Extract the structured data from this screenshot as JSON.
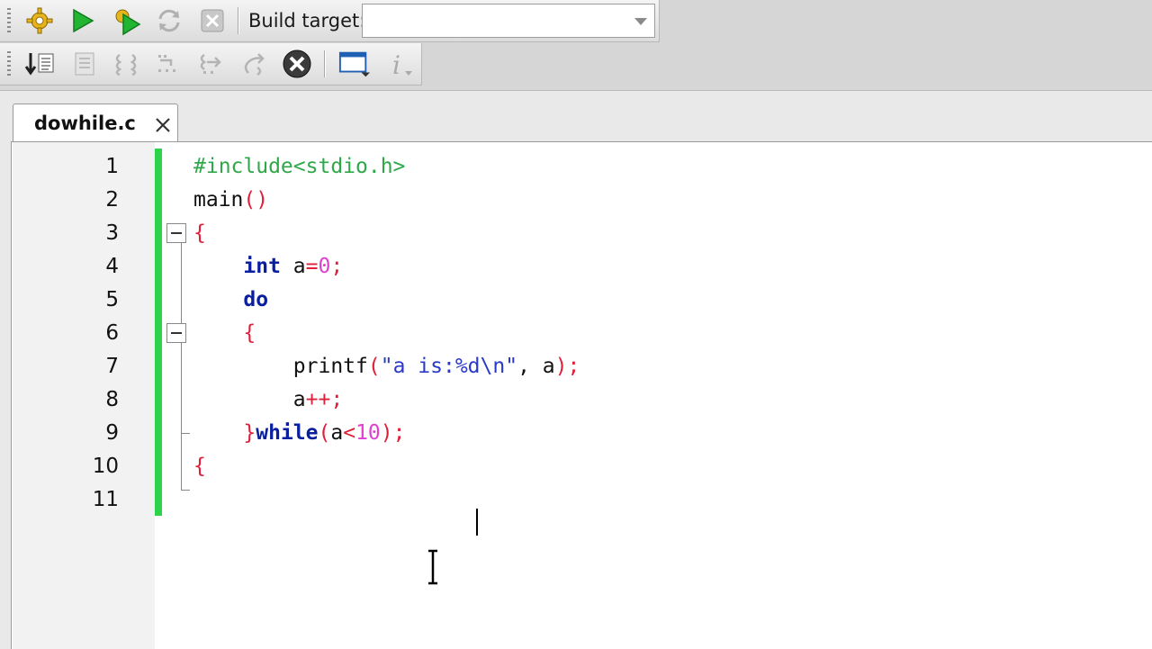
{
  "toolbar_build": {
    "label": "Build target:",
    "target_value": "",
    "buttons": [
      "build-icon",
      "run-icon",
      "build-run-icon",
      "rebuild-icon",
      "abort-icon"
    ]
  },
  "toolbar_debug": {
    "buttons": [
      "debug-icon",
      "run-to-cursor-icon",
      "next-line-icon",
      "step-into-icon",
      "step-out-icon",
      "next-instruction-icon",
      "stop-debugger-icon",
      "debug-windows-icon",
      "info-icon"
    ]
  },
  "editor": {
    "tab": {
      "label": "dowhile.c",
      "close": "×"
    },
    "line_numbers": [
      "1",
      "2",
      "3",
      "4",
      "5",
      "6",
      "7",
      "8",
      "9",
      "10",
      "11"
    ],
    "lines": [
      [
        {
          "t": "#include<stdio.h>",
          "c": "pre"
        }
      ],
      [
        {
          "t": "main",
          "c": "id"
        },
        {
          "t": "()",
          "c": "br"
        }
      ],
      [
        {
          "t": "{",
          "c": "br"
        }
      ],
      [
        {
          "t": "    ",
          "c": "id"
        },
        {
          "t": "int",
          "c": "kw"
        },
        {
          "t": " a",
          "c": "id"
        },
        {
          "t": "=",
          "c": "op"
        },
        {
          "t": "0",
          "c": "num"
        },
        {
          "t": ";",
          "c": "op"
        }
      ],
      [
        {
          "t": "    ",
          "c": "id"
        },
        {
          "t": "do",
          "c": "kw"
        }
      ],
      [
        {
          "t": "    ",
          "c": "id"
        },
        {
          "t": "{",
          "c": "br"
        }
      ],
      [
        {
          "t": "        printf",
          "c": "id"
        },
        {
          "t": "(",
          "c": "br"
        },
        {
          "t": "\"a is:%d\\n\"",
          "c": "str"
        },
        {
          "t": ", a",
          "c": "id"
        },
        {
          "t": ");",
          "c": "br"
        }
      ],
      [
        {
          "t": "        a",
          "c": "id"
        },
        {
          "t": "++;",
          "c": "op"
        }
      ],
      [
        {
          "t": "    ",
          "c": "id"
        },
        {
          "t": "}",
          "c": "br"
        },
        {
          "t": "while",
          "c": "kw"
        },
        {
          "t": "(",
          "c": "br"
        },
        {
          "t": "a",
          "c": "id"
        },
        {
          "t": "<",
          "c": "op"
        },
        {
          "t": "10",
          "c": "num"
        },
        {
          "t": ");",
          "c": "br"
        }
      ],
      [
        {
          "t": "{",
          "c": "br"
        }
      ],
      []
    ],
    "line9_fix": "}",
    "colors": {
      "change_bar": "#2ed34c",
      "keyword": "#0a1fa0",
      "preprocessor": "#2fa84a",
      "bracket": "#e0203a",
      "number": "#e040d0",
      "string": "#2a3ac8"
    }
  }
}
